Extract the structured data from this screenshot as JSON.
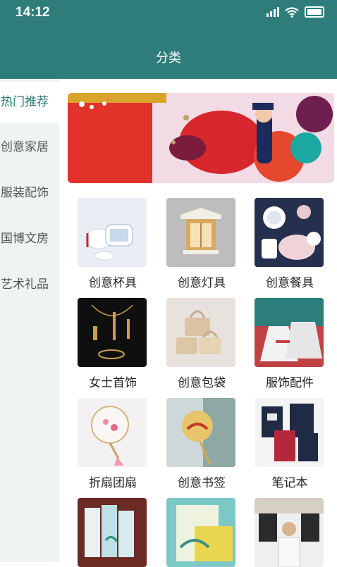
{
  "status": {
    "time": "14:12"
  },
  "header": {
    "title": "分类"
  },
  "sidebar": {
    "items": [
      {
        "label": "热门推荐",
        "active": true
      },
      {
        "label": "创意家居"
      },
      {
        "label": "服装配饰"
      },
      {
        "label": "国博文房"
      },
      {
        "label": "艺术礼品"
      }
    ]
  },
  "grid": {
    "items": [
      {
        "label": "创意杯具"
      },
      {
        "label": "创意灯具"
      },
      {
        "label": "创意餐具"
      },
      {
        "label": "女士首饰"
      },
      {
        "label": "创意包袋"
      },
      {
        "label": "服饰配件"
      },
      {
        "label": "折扇团扇"
      },
      {
        "label": "创意书签"
      },
      {
        "label": "笔记本"
      }
    ]
  },
  "colors": {
    "header": "#2f7d7a",
    "accent": "#2a7a74",
    "sidebar_bg": "#eef3f3"
  }
}
